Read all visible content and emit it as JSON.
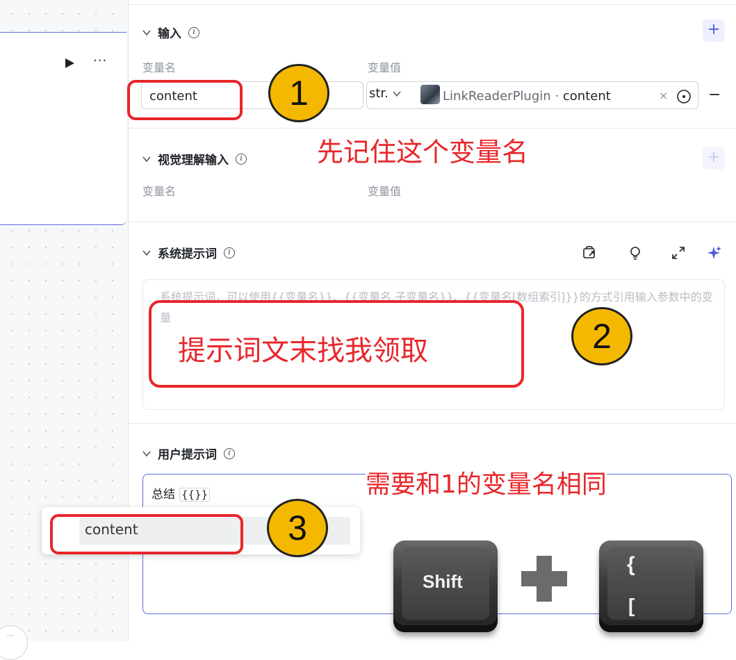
{
  "node": {
    "run_icon": "play-icon",
    "more_icon": "more-horizontal-icon",
    "more_label": "···"
  },
  "input_section": {
    "title": "输入",
    "col_name": "变量名",
    "col_value": "变量值",
    "var_name": "content",
    "type": "str.",
    "plugin_name": "LinkReaderPlugin",
    "plugin_sep": "·",
    "plugin_field": "content",
    "clear": "×",
    "minus": "−",
    "add": "+"
  },
  "vision_section": {
    "title": "视觉理解输入",
    "col_name": "变量名",
    "col_value": "变量值",
    "add": "+"
  },
  "system_prompt": {
    "title": "系统提示词",
    "placeholder": "系统提示词，可以使用{{变量名}}、{{变量名.子变量名}}、{{变量名[数组索引]}}的方式引用输入参数中的变量"
  },
  "user_prompt": {
    "title": "用户提示词",
    "text": "总结",
    "token": "{{}}"
  },
  "dropdown": {
    "option": "content"
  },
  "annotations": {
    "note1": "先记住这个变量名",
    "note2": "提示词文末找我领取",
    "note3": "需要和1的变量名相同",
    "num1": "1",
    "num2": "2",
    "num3": "3"
  },
  "keys": {
    "shift": "Shift",
    "brace_top": "{",
    "brace_bottom": "["
  },
  "colors": {
    "accent": "#4e5bd6",
    "annotation_red": "#e8262b",
    "badge_yellow": "#f5b800"
  }
}
